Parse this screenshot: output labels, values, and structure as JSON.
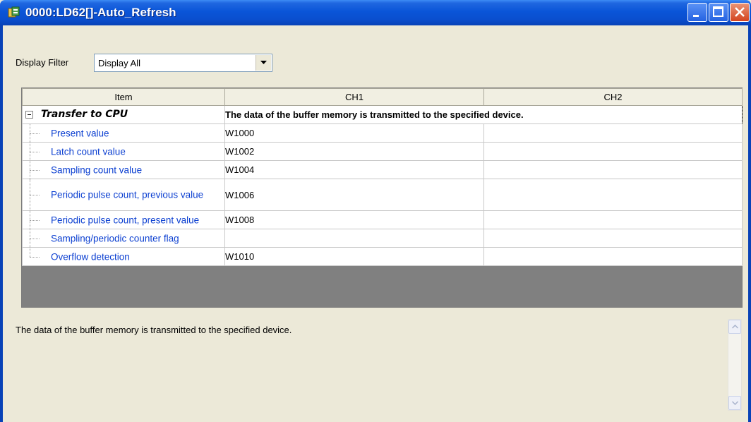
{
  "window": {
    "title": "0000:LD62[]-Auto_Refresh",
    "icon": "module-app-icon",
    "controls": {
      "minimize": "minimize-icon",
      "maximize": "maximize-icon",
      "close": "close-icon"
    }
  },
  "filter": {
    "label": "Display Filter",
    "value": "Display All",
    "arrow_icon": "chevron-down-icon"
  },
  "grid": {
    "columns": [
      "Item",
      "CH1",
      "CH2"
    ],
    "group": {
      "label": "Transfer to CPU",
      "description": "The data of the buffer memory is transmitted to the specified device.",
      "expander_icon": "collapse-minus-icon"
    },
    "rows": [
      {
        "label": "Present value",
        "ch1": "W1000",
        "ch2": ""
      },
      {
        "label": "Latch count value",
        "ch1": "W1002",
        "ch2": ""
      },
      {
        "label": "Sampling count value",
        "ch1": "W1004",
        "ch2": ""
      },
      {
        "label": "Periodic pulse count, previous value",
        "ch1": "W1006",
        "ch2": ""
      },
      {
        "label": "Periodic pulse count, present value",
        "ch1": "W1008",
        "ch2": ""
      },
      {
        "label": "Sampling/periodic counter flag",
        "ch1": "",
        "ch2": ""
      },
      {
        "label": "Overflow detection",
        "ch1": "W1010",
        "ch2": ""
      }
    ]
  },
  "description": {
    "text": "The data of the buffer memory is transmitted to the specified device."
  },
  "colors": {
    "titlebar": "#0a55d8",
    "item_text": "#0b3fd1",
    "background": "#ece9d8",
    "grid_empty": "#808080"
  }
}
